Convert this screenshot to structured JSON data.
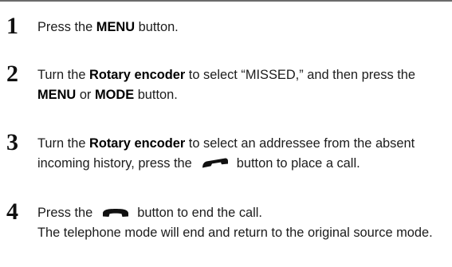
{
  "steps": [
    {
      "number": "1",
      "t1": "Press the ",
      "b1": "MENU",
      "t2": " button."
    },
    {
      "number": "2",
      "t1": "Turn the ",
      "b1": "Rotary encoder",
      "t2": " to select “MISSED,” and then press the ",
      "b2": "MENU",
      "t3": " or ",
      "b3": "MODE",
      "t4": " button."
    },
    {
      "number": "3",
      "t1": "Turn the ",
      "b1": "Rotary encoder",
      "t2": " to select an addressee from the absent incoming history, press the",
      "icon": "call-send-phone-icon",
      "t3": "button to place a call."
    },
    {
      "number": "4",
      "t1": "Press the",
      "icon": "call-end-phone-icon",
      "t2": "button to end the call.",
      "t3": "The telephone mode will end and return to the original source mode."
    }
  ]
}
